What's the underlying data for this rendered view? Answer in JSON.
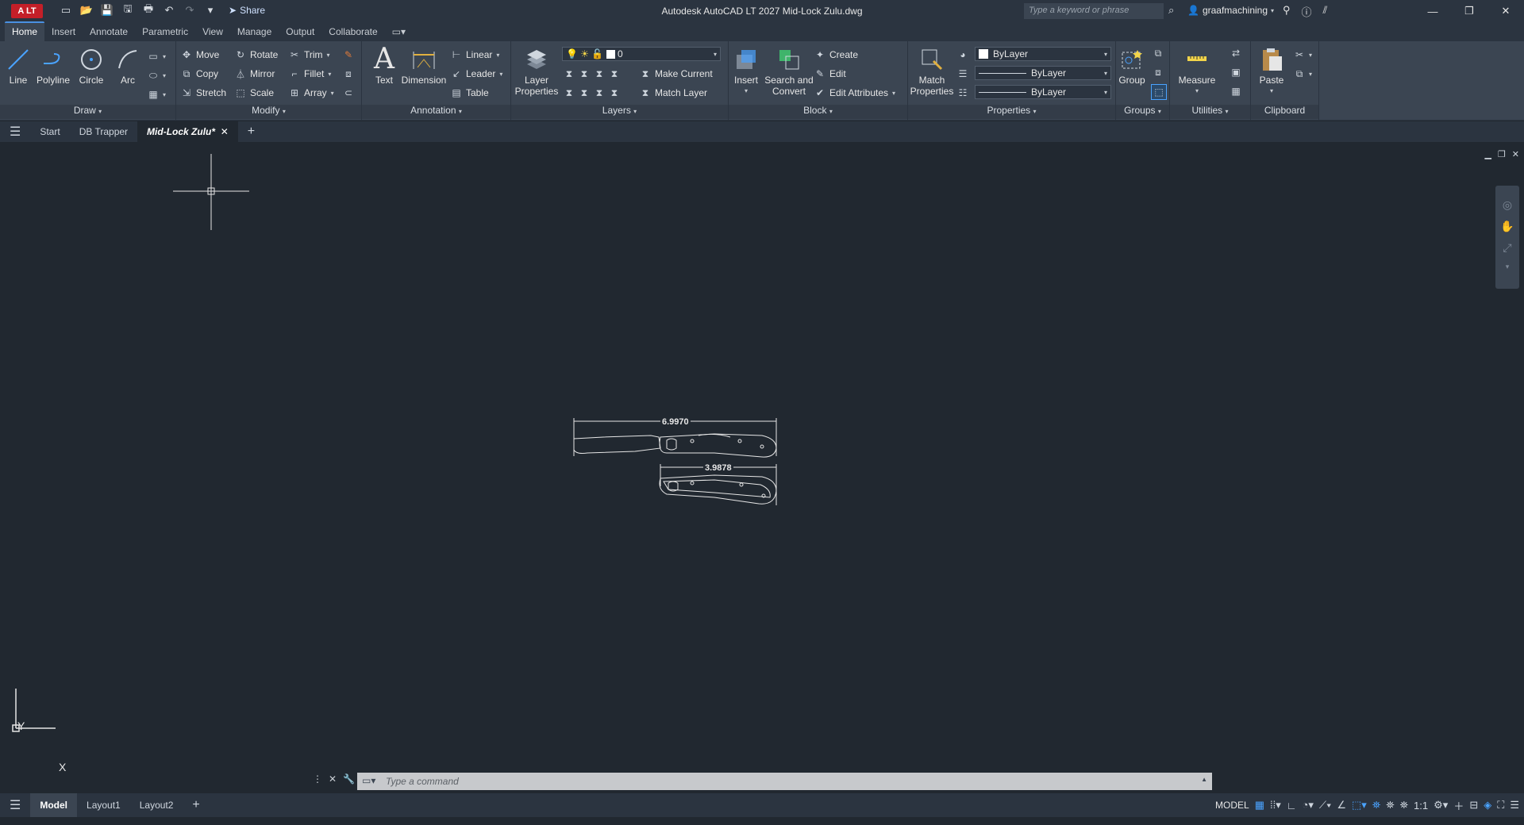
{
  "app": {
    "logo": "A LT",
    "title": "Autodesk AutoCAD LT 2027   Mid-Lock Zulu.dwg",
    "share": "Share",
    "search_placeholder": "Type a keyword or phrase",
    "user": "graafmachining"
  },
  "ribbon_tabs": [
    "Home",
    "Insert",
    "Annotate",
    "Parametric",
    "View",
    "Manage",
    "Output",
    "Collaborate"
  ],
  "draw": {
    "title": "Draw",
    "line": "Line",
    "polyline": "Polyline",
    "circle": "Circle",
    "arc": "Arc"
  },
  "modify": {
    "title": "Modify",
    "move": "Move",
    "rotate": "Rotate",
    "trim": "Trim",
    "copy": "Copy",
    "mirror": "Mirror",
    "fillet": "Fillet",
    "stretch": "Stretch",
    "scale": "Scale",
    "array": "Array"
  },
  "annotation": {
    "title": "Annotation",
    "text": "Text",
    "dimension": "Dimension",
    "linear": "Linear",
    "leader": "Leader",
    "table": "Table"
  },
  "layers": {
    "title": "Layers",
    "layer_properties_1": "Layer",
    "layer_properties_2": "Properties",
    "current_layer": "0",
    "make_current": "Make Current",
    "match_layer": "Match Layer"
  },
  "block": {
    "title": "Block",
    "insert": "Insert",
    "search_convert_1": "Search and",
    "search_convert_2": "Convert",
    "create": "Create",
    "edit": "Edit",
    "edit_attributes": "Edit Attributes"
  },
  "properties": {
    "title": "Properties",
    "match_1": "Match",
    "match_2": "Properties",
    "color": "ByLayer",
    "linetype": "ByLayer",
    "lineweight": "ByLayer"
  },
  "groups": {
    "title": "Groups",
    "group": "Group"
  },
  "utilities": {
    "title": "Utilities",
    "measure": "Measure"
  },
  "clipboard": {
    "title": "Clipboard",
    "paste": "Paste"
  },
  "file_tabs": [
    "Start",
    "DB Trapper",
    "Mid-Lock Zulu*"
  ],
  "drawing": {
    "dim_overall": "6.9970",
    "dim_handle": "3.9878"
  },
  "ucs": {
    "x": "X",
    "y": "Y"
  },
  "command": {
    "placeholder": "Type a command"
  },
  "layout_tabs": [
    "Model",
    "Layout1",
    "Layout2"
  ],
  "status": {
    "model": "MODEL",
    "scale": "1:1"
  },
  "colors": {
    "accent": "#4a90e2",
    "background": "#212830",
    "ribbon": "#3b4552",
    "logo": "#c41f28"
  }
}
